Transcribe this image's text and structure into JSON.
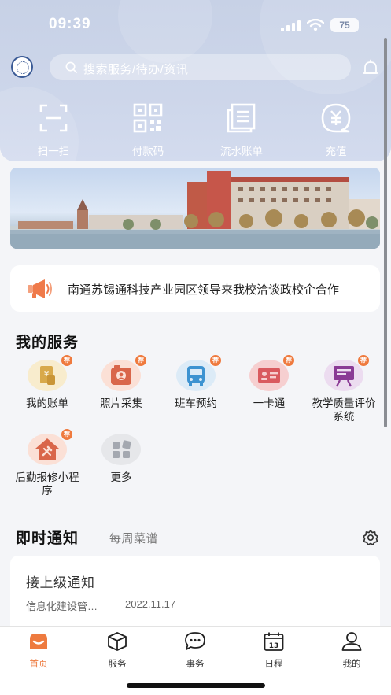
{
  "status_bar": {
    "time": "09:39",
    "battery": "75"
  },
  "header": {
    "search_placeholder": "搜索服务/待办/资讯",
    "quick_actions": [
      {
        "label": "扫一扫",
        "icon": "scan-icon"
      },
      {
        "label": "付款码",
        "icon": "qr-code-icon"
      },
      {
        "label": "流水账单",
        "icon": "bill-icon"
      },
      {
        "label": "充值",
        "icon": "recharge-icon"
      }
    ]
  },
  "notice_bar": {
    "text": "南通苏锡通科技产业园区领导来我校洽谈政校企合作"
  },
  "my_services": {
    "title": "我的服务",
    "badge": "荐",
    "items": [
      {
        "label": "我的账单",
        "icon": "bill-wallet-icon",
        "recommended": true
      },
      {
        "label": "照片采集",
        "icon": "camera-icon",
        "recommended": true
      },
      {
        "label": "班车预约",
        "icon": "bus-icon",
        "recommended": true
      },
      {
        "label": "一卡通",
        "icon": "id-card-icon",
        "recommended": true
      },
      {
        "label": "教学质量评价系统",
        "icon": "presentation-icon",
        "recommended": true
      },
      {
        "label": "后勤报修小程序",
        "icon": "repair-house-icon",
        "recommended": true
      },
      {
        "label": "更多",
        "icon": "more-grid-icon",
        "recommended": false
      }
    ]
  },
  "news": {
    "tab_active": "即时通知",
    "tab_inactive": "每周菜谱",
    "card": {
      "title": "接上级通知",
      "source": "信息化建设管…",
      "date": "2022.11.17"
    }
  },
  "tabbar": {
    "items": [
      {
        "label": "首页",
        "icon": "home-icon",
        "active": true
      },
      {
        "label": "服务",
        "icon": "cube-icon",
        "active": false
      },
      {
        "label": "事务",
        "icon": "chat-icon",
        "active": false
      },
      {
        "label": "日程",
        "icon": "calendar-icon",
        "active": false
      },
      {
        "label": "我的",
        "icon": "user-icon",
        "active": false
      }
    ]
  },
  "colors": {
    "accent": "#ee7a3f",
    "header_bg": "#c9d3e8"
  }
}
